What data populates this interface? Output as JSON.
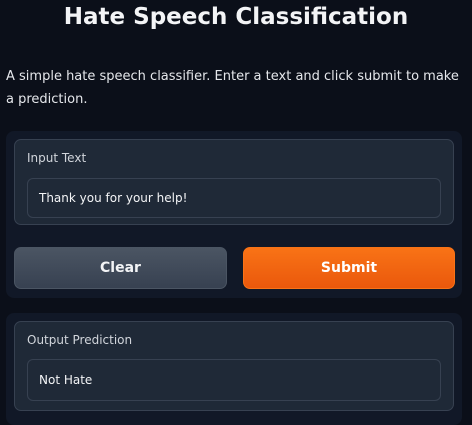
{
  "page": {
    "title": "Hate Speech Classification",
    "description": "A simple hate speech classifier. Enter a text and click submit to make a prediction."
  },
  "input": {
    "label": "Input Text",
    "value": "Thank you for your help!"
  },
  "actions": {
    "clear_label": "Clear",
    "submit_label": "Submit"
  },
  "output": {
    "label": "Output Prediction",
    "value": "Not Hate"
  },
  "colors": {
    "background": "#0b0f19",
    "panel": "#111827",
    "block": "#1f2937",
    "border": "#374151",
    "submit": "#f97316",
    "clear": "#4b5563"
  }
}
